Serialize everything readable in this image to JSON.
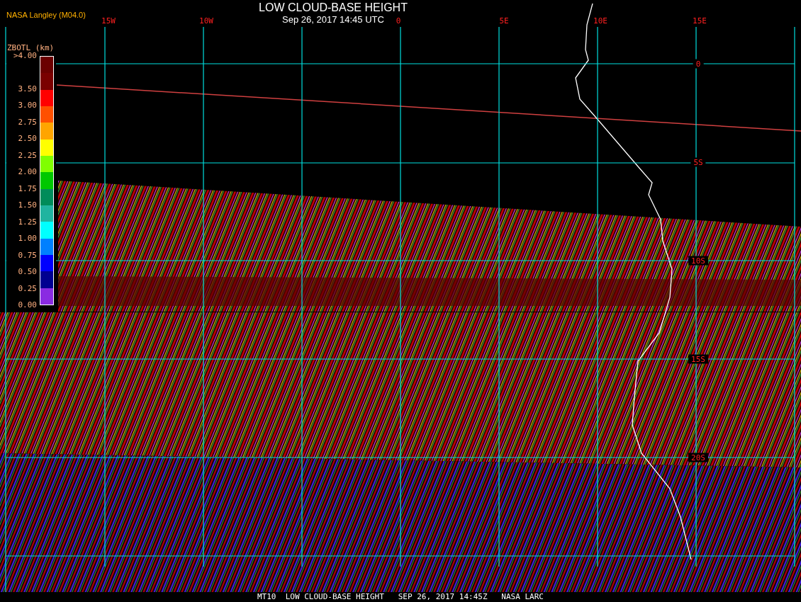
{
  "title": "LOW CLOUD-BASE HEIGHT",
  "subtitle": "Sep 26, 2017 14:45 UTC",
  "credit": "NASA Langley (M04.0)",
  "lon_labels": [
    "15W",
    "10W",
    "0",
    "5E",
    "10E",
    "15E"
  ],
  "lat_labels": [
    "0",
    "5S",
    "10S",
    "15S",
    "20S"
  ],
  "legend": {
    "title": "ZBOTL (km)",
    "labels": [
      ">4.00",
      "3.50",
      "3.00",
      "2.75",
      "2.50",
      "2.25",
      "2.00",
      "1.75",
      "1.50",
      "1.25",
      "1.00",
      "0.75",
      "0.50",
      "0.25",
      "0.00"
    ],
    "segments": [
      {
        "color": "#6b0000"
      },
      {
        "color": "#7a0000"
      },
      {
        "color": "#ff0000"
      },
      {
        "color": "#ff5000"
      },
      {
        "color": "#ffa500"
      },
      {
        "color": "#ffff00"
      },
      {
        "color": "#80ff00"
      },
      {
        "color": "#00c800"
      },
      {
        "color": "#008c5a"
      },
      {
        "color": "#20b4a0"
      },
      {
        "color": "#00ffff"
      },
      {
        "color": "#0080ff"
      },
      {
        "color": "#0000ff"
      },
      {
        "color": "#000090"
      },
      {
        "color": "#8a2be2"
      }
    ]
  },
  "footer": "MT10  LOW CLOUD-BASE HEIGHT   SEP 26, 2017 14:45Z   NASA LARC"
}
